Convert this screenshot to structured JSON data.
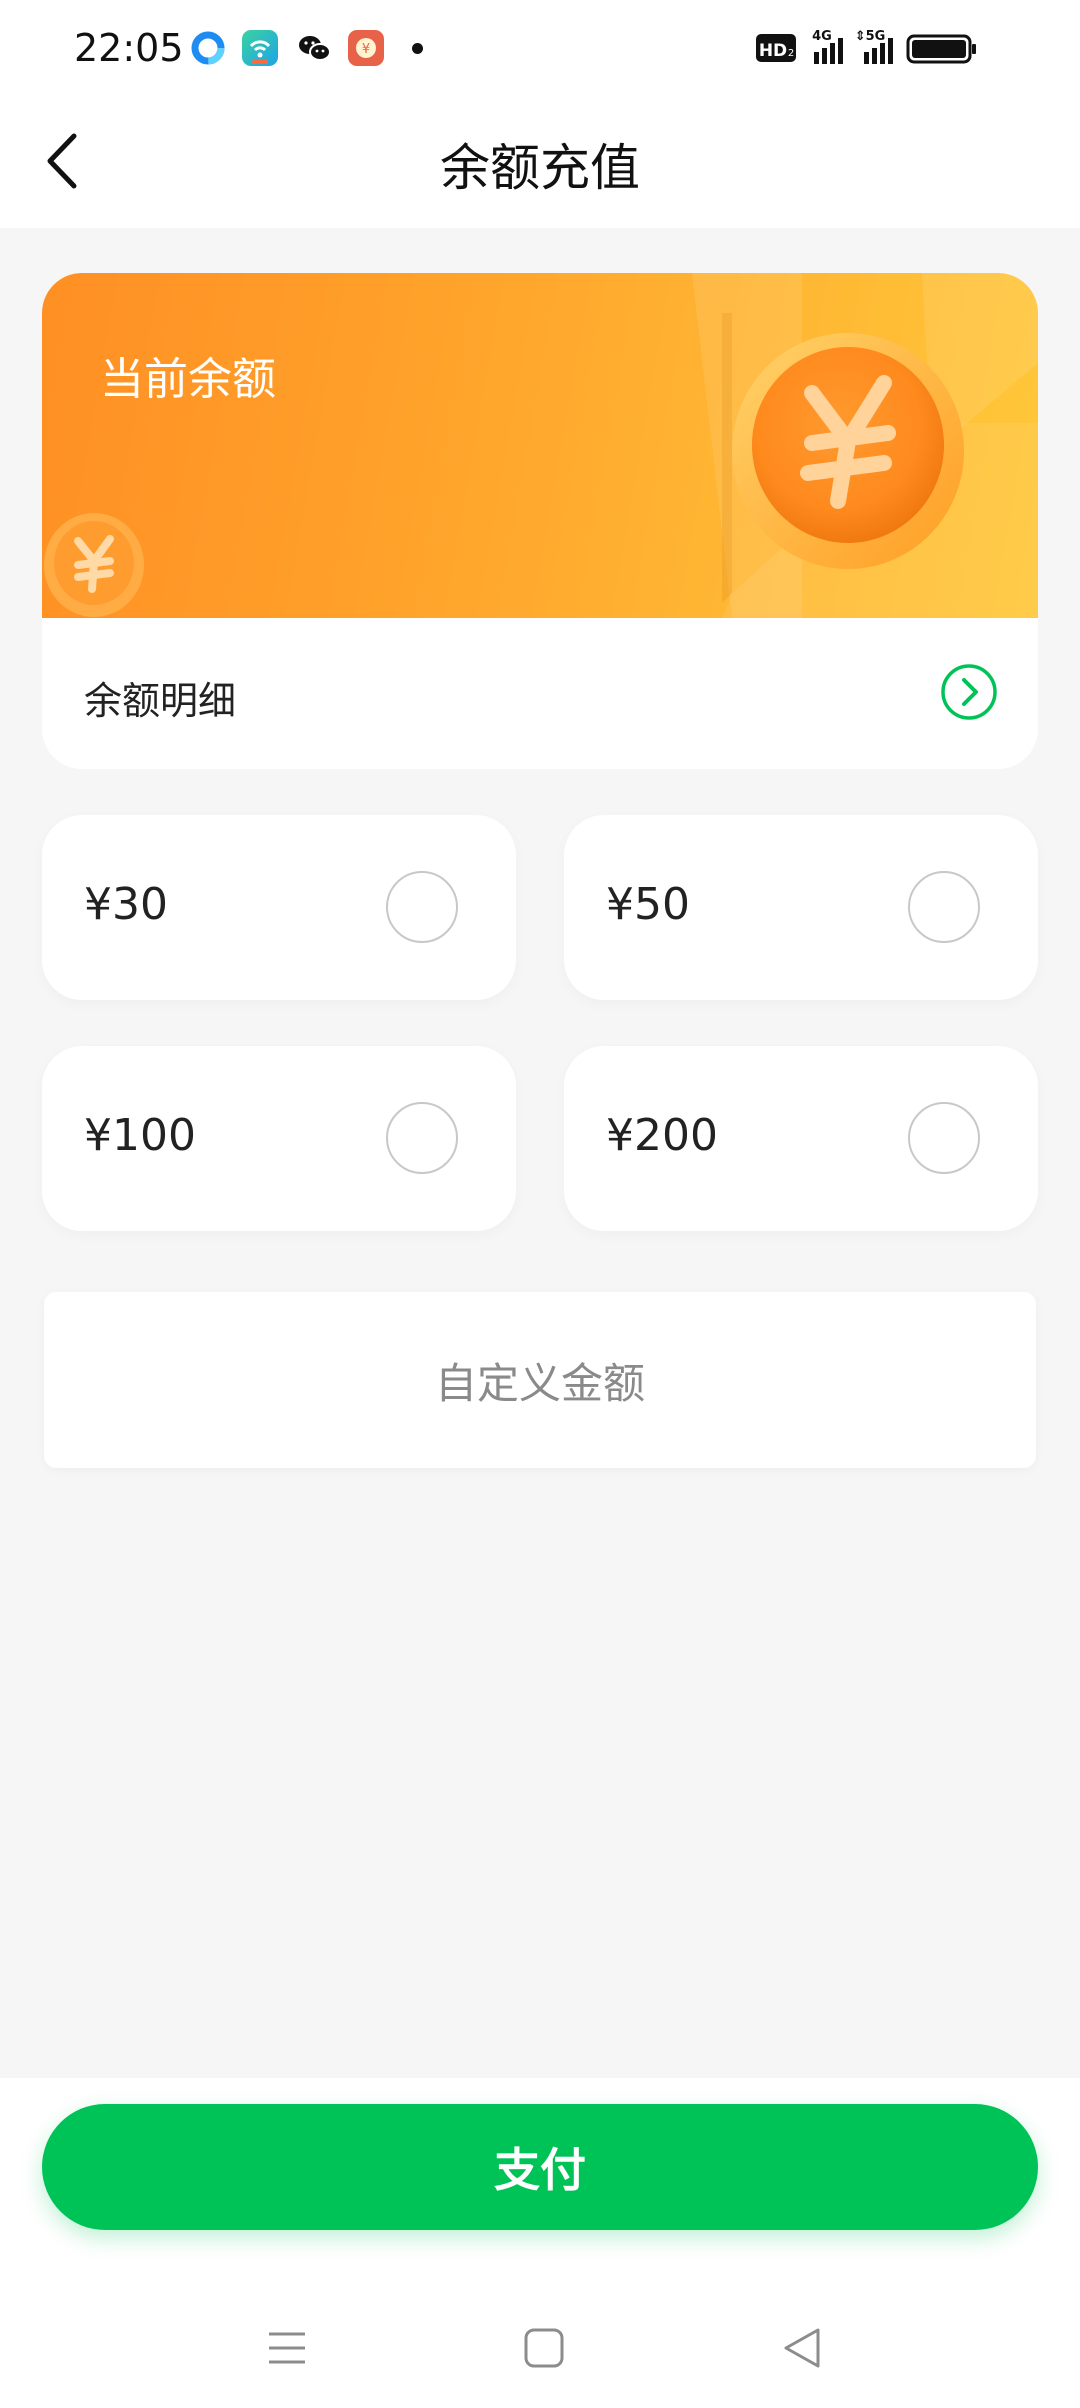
{
  "status_bar": {
    "time": "22:05",
    "icons": [
      "browser-app-icon",
      "wifi-share-app-icon",
      "wechat-icon",
      "taobao-app-icon",
      "notification-dot"
    ],
    "hd_badge": "HD",
    "network_4g": "4G",
    "network_5g": "5G",
    "battery_icon": "battery-full-icon"
  },
  "header": {
    "title": "余额充值",
    "back_icon": "chevron-left-icon"
  },
  "balance_card": {
    "label": "当前余额",
    "detail_label": "余额明细",
    "detail_icon": "chevron-right-circle-icon"
  },
  "amount_options": [
    {
      "label": "¥30",
      "selected": false
    },
    {
      "label": "¥50",
      "selected": false
    },
    {
      "label": "¥100",
      "selected": false
    },
    {
      "label": "¥200",
      "selected": false
    }
  ],
  "custom_amount": {
    "placeholder": "自定义金额"
  },
  "pay_button": {
    "label": "支付"
  },
  "nav_bar": {
    "icons": [
      "menu-icon",
      "home-square-icon",
      "back-triangle-icon"
    ]
  },
  "colors": {
    "accent_green": "#00c357",
    "banner_orange": "#ff8f24",
    "banner_yellow": "#ffc83a",
    "background": "#f6f6f6"
  }
}
